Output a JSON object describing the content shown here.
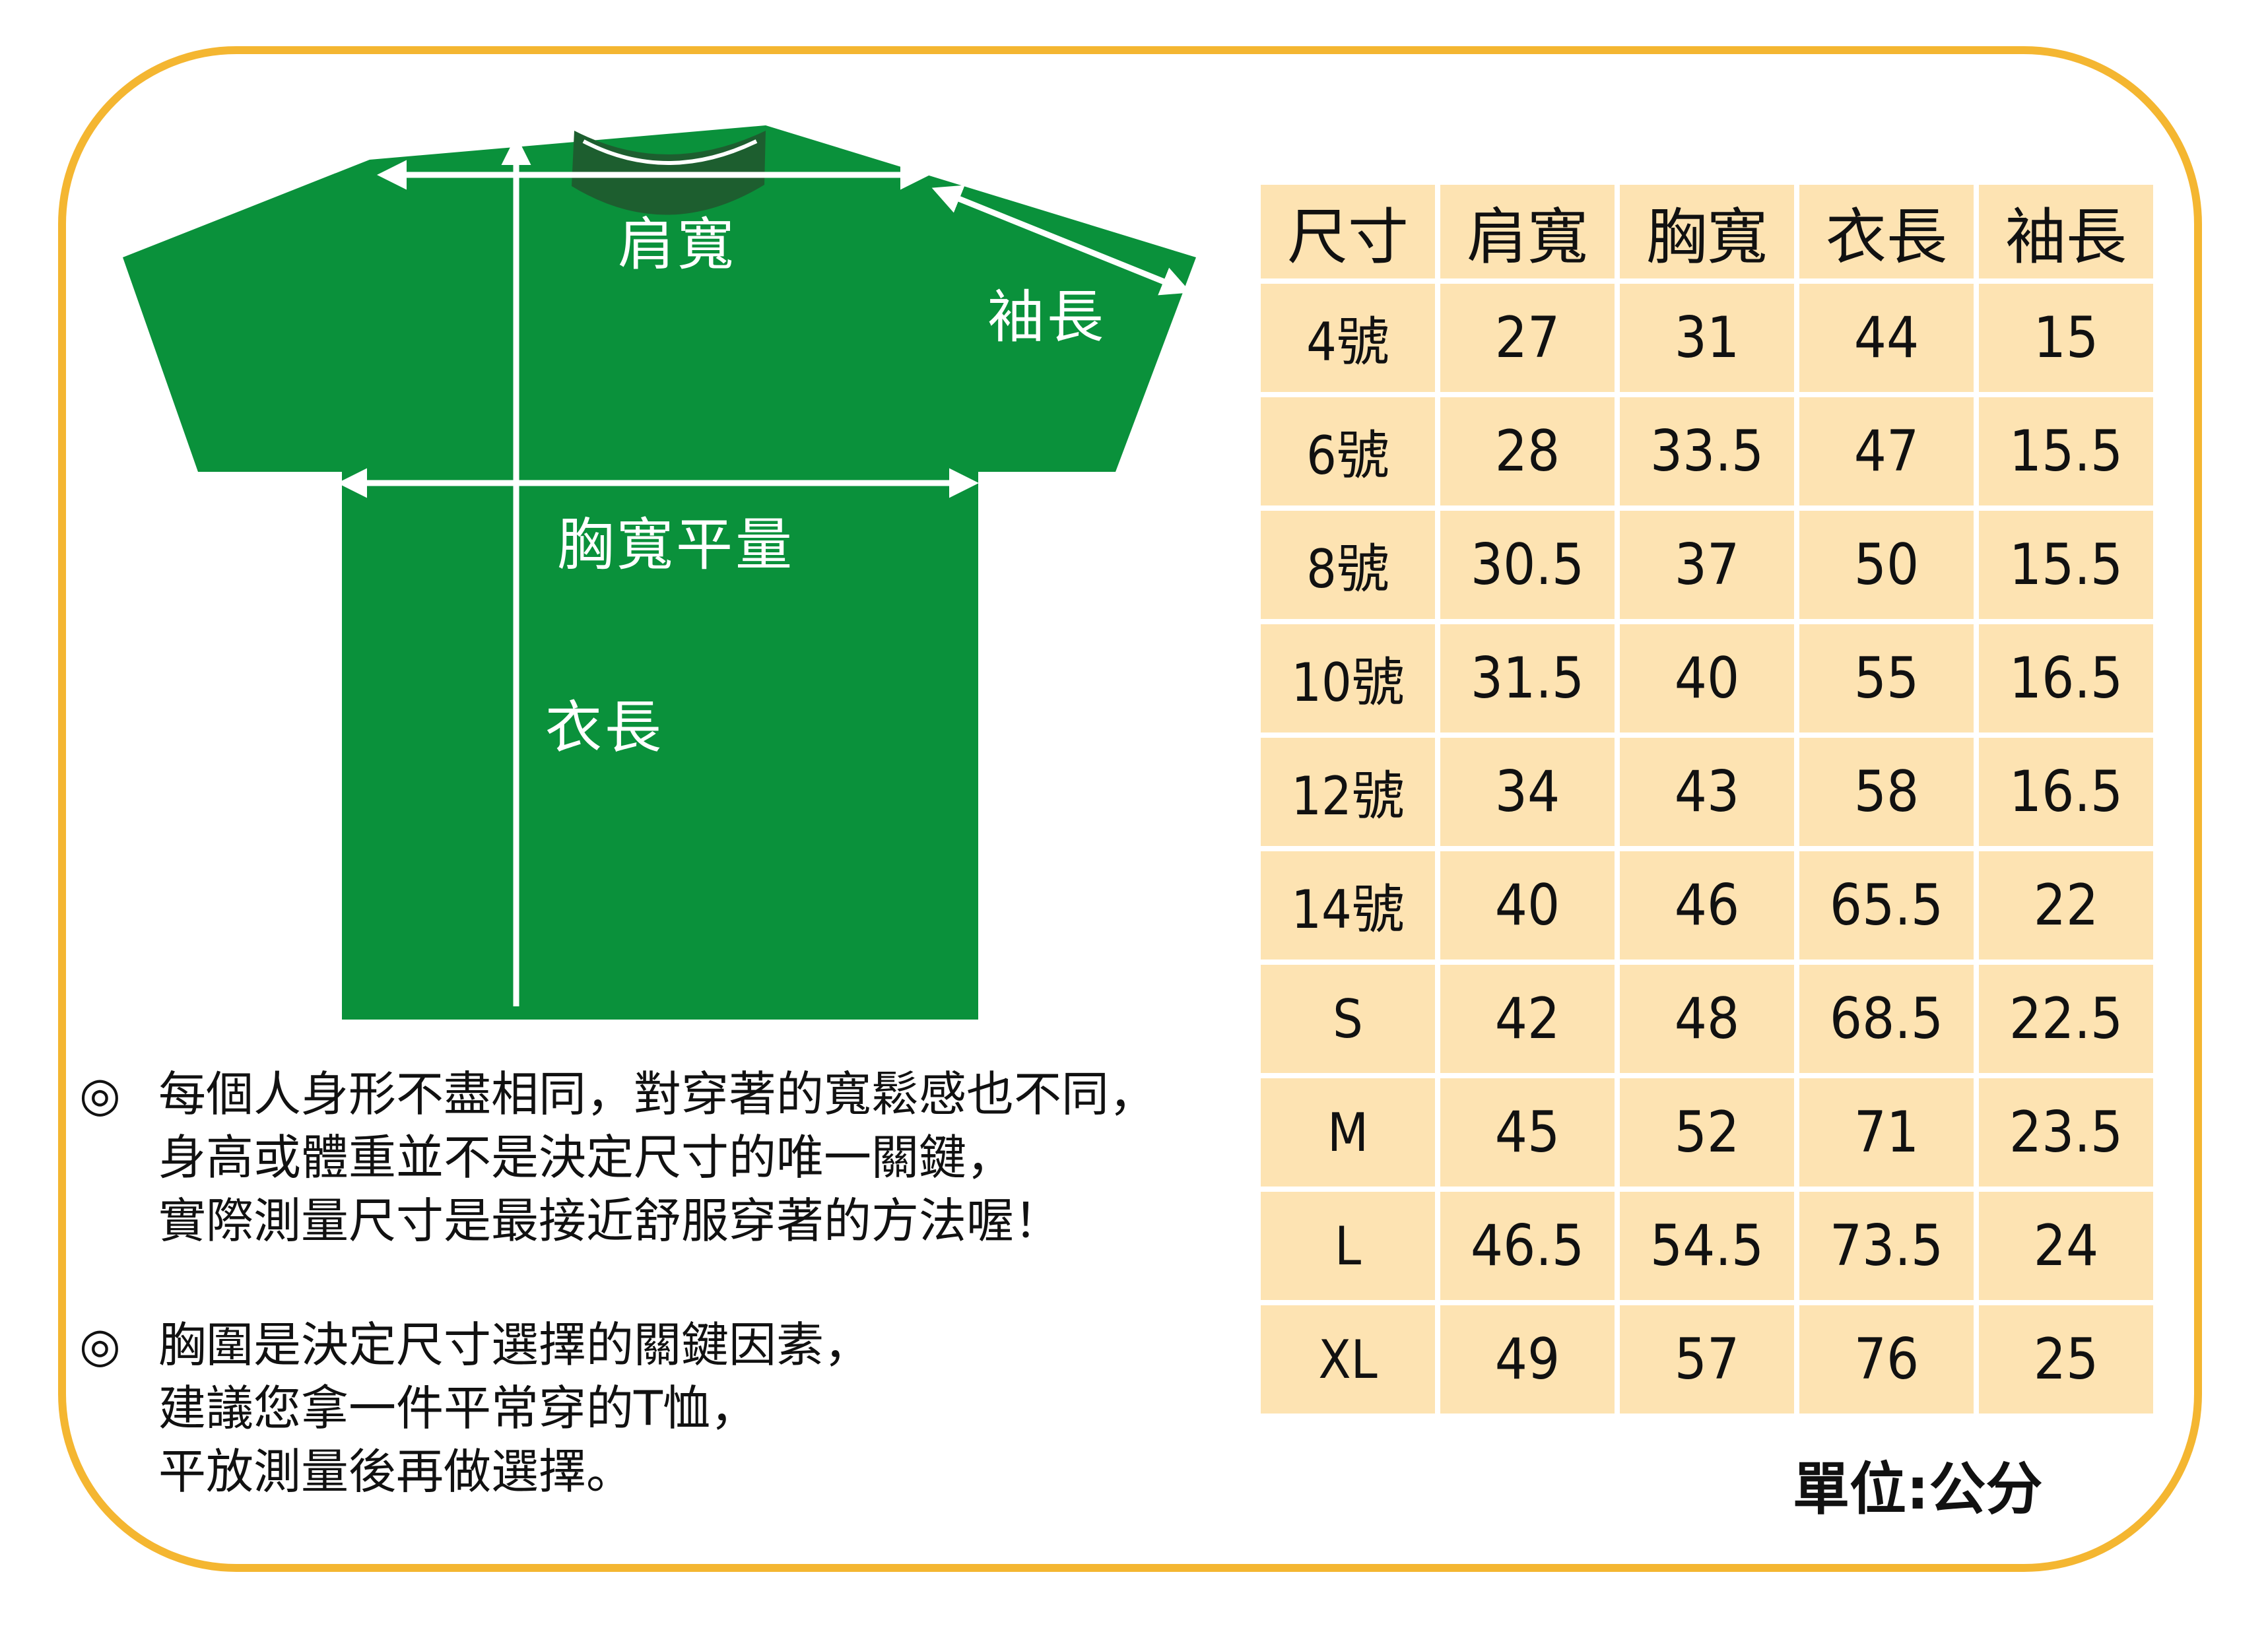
{
  "colors": {
    "frame": "#f4b631",
    "shirt": "#0a913b",
    "collar": "#1d5e2f",
    "cell": "#fde3b2",
    "arrow": "#ffffff"
  },
  "shirt_labels": {
    "shoulder": "肩寬",
    "sleeve": "袖長",
    "chest": "胸寬平量",
    "length": "衣長"
  },
  "table": {
    "headers": [
      "尺寸",
      "肩寬",
      "胸寬",
      "衣長",
      "袖長"
    ],
    "rows": [
      [
        "4號",
        "27",
        "31",
        "44",
        "15"
      ],
      [
        "6號",
        "28",
        "33.5",
        "47",
        "15.5"
      ],
      [
        "8號",
        "30.5",
        "37",
        "50",
        "15.5"
      ],
      [
        "10號",
        "31.5",
        "40",
        "55",
        "16.5"
      ],
      [
        "12號",
        "34",
        "43",
        "58",
        "16.5"
      ],
      [
        "14號",
        "40",
        "46",
        "65.5",
        "22"
      ],
      [
        "S",
        "42",
        "48",
        "68.5",
        "22.5"
      ],
      [
        "M",
        "45",
        "52",
        "71",
        "23.5"
      ],
      [
        "L",
        "46.5",
        "54.5",
        "73.5",
        "24"
      ],
      [
        "XL",
        "49",
        "57",
        "76",
        "25"
      ]
    ]
  },
  "notes": [
    {
      "bullet": "◎",
      "lines": [
        "每個人身形不盡相同，對穿著的寬鬆感也不同，",
        "身高或體重並不是決定尺寸的唯一關鍵，",
        "實際測量尺寸是最接近舒服穿著的方法喔！"
      ]
    },
    {
      "bullet": "◎",
      "lines": [
        "胸圍是決定尺寸選擇的關鍵因素，",
        "建議您拿一件平常穿的T恤，",
        "平放測量後再做選擇。"
      ]
    }
  ],
  "unit": "單位:公分"
}
